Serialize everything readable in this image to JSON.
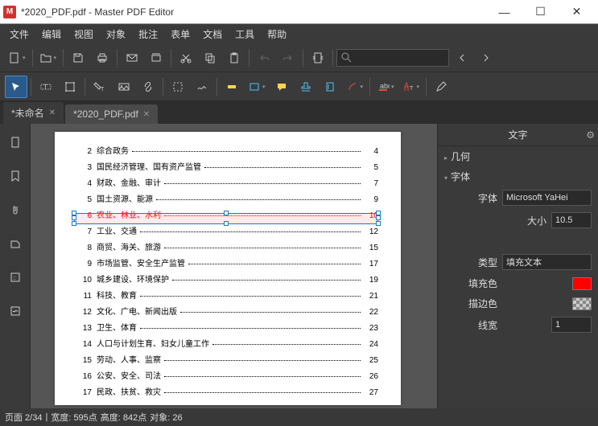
{
  "window": {
    "title": "*2020_PDF.pdf - Master PDF Editor"
  },
  "menu": {
    "items": [
      "文件",
      "编辑",
      "视图",
      "对象",
      "批注",
      "表单",
      "文档",
      "工具",
      "帮助"
    ]
  },
  "search": {
    "placeholder": ""
  },
  "tabs": [
    {
      "label": "*未命名",
      "active": false
    },
    {
      "label": "*2020_PDF.pdf",
      "active": true
    }
  ],
  "toc": [
    {
      "n": "2",
      "t": "综合政务",
      "p": "4"
    },
    {
      "n": "3",
      "t": "国民经济管理、国有资产监管",
      "p": "5"
    },
    {
      "n": "4",
      "t": "财政、金融、审计",
      "p": "7"
    },
    {
      "n": "5",
      "t": "国土资源、能源",
      "p": "9"
    },
    {
      "n": "6",
      "t": "农业、林业、水利",
      "p": "10",
      "sel": true
    },
    {
      "n": "7",
      "t": "工业、交通",
      "p": "12"
    },
    {
      "n": "8",
      "t": "商贸、海关、旅游",
      "p": "15"
    },
    {
      "n": "9",
      "t": "市场监管、安全生产监管",
      "p": "17"
    },
    {
      "n": "10",
      "t": "城乡建设、环境保护",
      "p": "19"
    },
    {
      "n": "11",
      "t": "科技、教育",
      "p": "21"
    },
    {
      "n": "12",
      "t": "文化、广电、新闻出版",
      "p": "22"
    },
    {
      "n": "13",
      "t": "卫生、体育",
      "p": "23"
    },
    {
      "n": "14",
      "t": "人口与计划生育、妇女儿童工作",
      "p": "24"
    },
    {
      "n": "15",
      "t": "劳动、人事、监察",
      "p": "25"
    },
    {
      "n": "16",
      "t": "公安、安全、司法",
      "p": "26"
    },
    {
      "n": "17",
      "t": "民政、扶贫、救灾",
      "p": "27"
    }
  ],
  "props": {
    "title": "文字",
    "sec_geometry": "几何",
    "sec_font": "字体",
    "font_lbl": "字体",
    "font_val": "Microsoft YaHei",
    "size_lbl": "大小",
    "size_val": "10.5",
    "type_lbl": "类型",
    "type_val": "填充文本",
    "fill_lbl": "填充色",
    "fill_val": "#ff0000",
    "stroke_lbl": "描边色",
    "stroke_val": "transparent",
    "linew_lbl": "线宽",
    "linew_val": "1"
  },
  "status": {
    "page": "页面 2/34",
    "width": "宽度: 595点",
    "height": "高度: 842点",
    "objects": "对象: 26"
  }
}
